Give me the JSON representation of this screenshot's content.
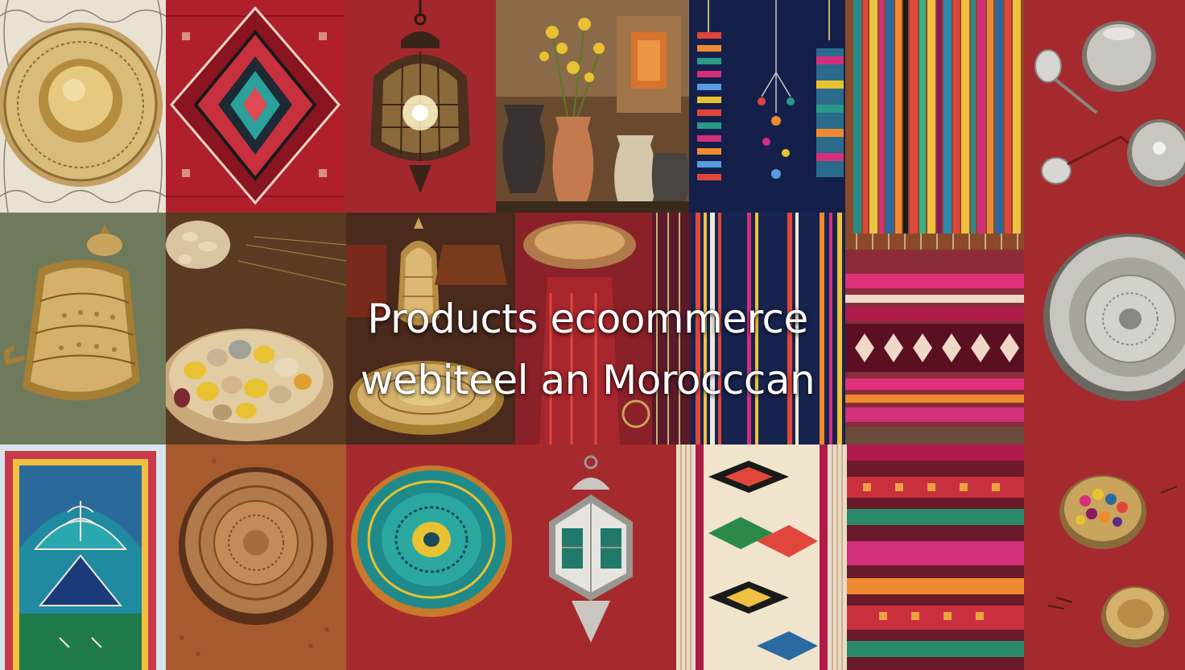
{
  "headline": {
    "line1": "Products ecoommerce",
    "line2": "webiteel  an Morocccan"
  },
  "palette": {
    "moroccan_red": "#a52a2e",
    "deep_red": "#7d1a1f",
    "brass": "#c9a45c",
    "silver": "#c9c6c0",
    "teal": "#1f8a8a",
    "navy": "#17244f",
    "olive_bg": "#6f7a5c"
  },
  "tiles": [
    {
      "name": "brass-tray-tile",
      "icon": "brass-tray-icon"
    },
    {
      "name": "red-rug-tile",
      "icon": "rug-icon"
    },
    {
      "name": "hanging-lantern-tile",
      "icon": "lantern-icon"
    },
    {
      "name": "pottery-vases-tile",
      "icon": "vase-icon"
    },
    {
      "name": "hanging-tassels-tile",
      "icon": "tassel-icon"
    },
    {
      "name": "striped-rug-tile",
      "icon": "rug-icon"
    },
    {
      "name": "silver-teaware-tile",
      "icon": "teapot-icon"
    },
    {
      "name": "brass-urn-tile",
      "icon": "urn-icon"
    },
    {
      "name": "dried-fruits-tile",
      "icon": "fruit-bowl-icon"
    },
    {
      "name": "brass-lamps-tile",
      "icon": "lamp-icon"
    },
    {
      "name": "red-textile-tile",
      "icon": "textile-icon"
    },
    {
      "name": "navy-striped-rug-tile",
      "icon": "rug-icon"
    },
    {
      "name": "silver-bowl-tile",
      "icon": "bowl-icon"
    },
    {
      "name": "blue-prayer-rug-tile",
      "icon": "rug-icon"
    },
    {
      "name": "woven-basket-tile",
      "icon": "basket-icon"
    },
    {
      "name": "teal-ceramic-plate-tile",
      "icon": "plate-icon"
    },
    {
      "name": "silver-lantern-tile",
      "icon": "lantern-icon"
    },
    {
      "name": "kilim-rug-tile",
      "icon": "rug-icon"
    },
    {
      "name": "pink-woven-rug-tile",
      "icon": "rug-icon"
    },
    {
      "name": "spice-bowls-tile",
      "icon": "spice-bowl-icon"
    }
  ]
}
